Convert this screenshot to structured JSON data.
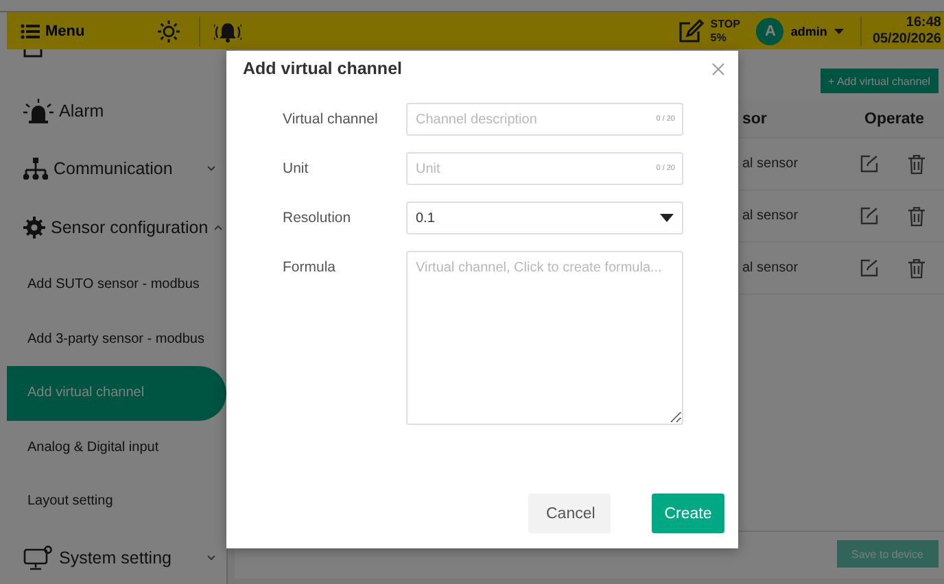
{
  "header": {
    "menu_label": "Menu",
    "status": {
      "line1": "STOP",
      "line2": "5%"
    },
    "user": {
      "initial": "A",
      "name": "admin"
    },
    "time": "16:48",
    "date": "05/20/2026"
  },
  "sidebar": {
    "items": [
      {
        "label": "Alarm"
      },
      {
        "label": "Communication",
        "expanded": false
      },
      {
        "label": "Sensor configuration",
        "expanded": true,
        "children": [
          {
            "label": "Add SUTO sensor - modbus",
            "selected": false
          },
          {
            "label": "Add 3-party sensor - modbus",
            "selected": false
          },
          {
            "label": "Add virtual channel",
            "selected": true
          },
          {
            "label": "Analog & Digital input",
            "selected": false
          },
          {
            "label": "Layout setting",
            "selected": false
          }
        ]
      },
      {
        "label": "System setting",
        "expanded": false
      }
    ]
  },
  "main": {
    "add_button": "+ Add virtual channel",
    "columns": [
      "sor",
      "Operate"
    ],
    "rows": [
      {
        "column_1": "al sensor"
      },
      {
        "column_1": "al sensor"
      },
      {
        "column_1": "al sensor"
      }
    ],
    "save_button": "Save to device"
  },
  "dialog": {
    "title": "Add virtual channel",
    "fields": [
      {
        "kind": "text",
        "label": "Virtual channel",
        "placeholder": "Channel description",
        "counter": "0 / 20"
      },
      {
        "kind": "text",
        "label": "Unit",
        "placeholder": "Unit",
        "counter": "0 / 20"
      },
      {
        "kind": "select",
        "label": "Resolution",
        "value": "0.1"
      },
      {
        "kind": "textarea",
        "label": "Formula",
        "placeholder": "Virtual channel, Click to create formula..."
      }
    ],
    "buttons": [
      {
        "label": "Cancel",
        "kind": "secondary"
      },
      {
        "label": "Create",
        "kind": "primary"
      }
    ]
  }
}
